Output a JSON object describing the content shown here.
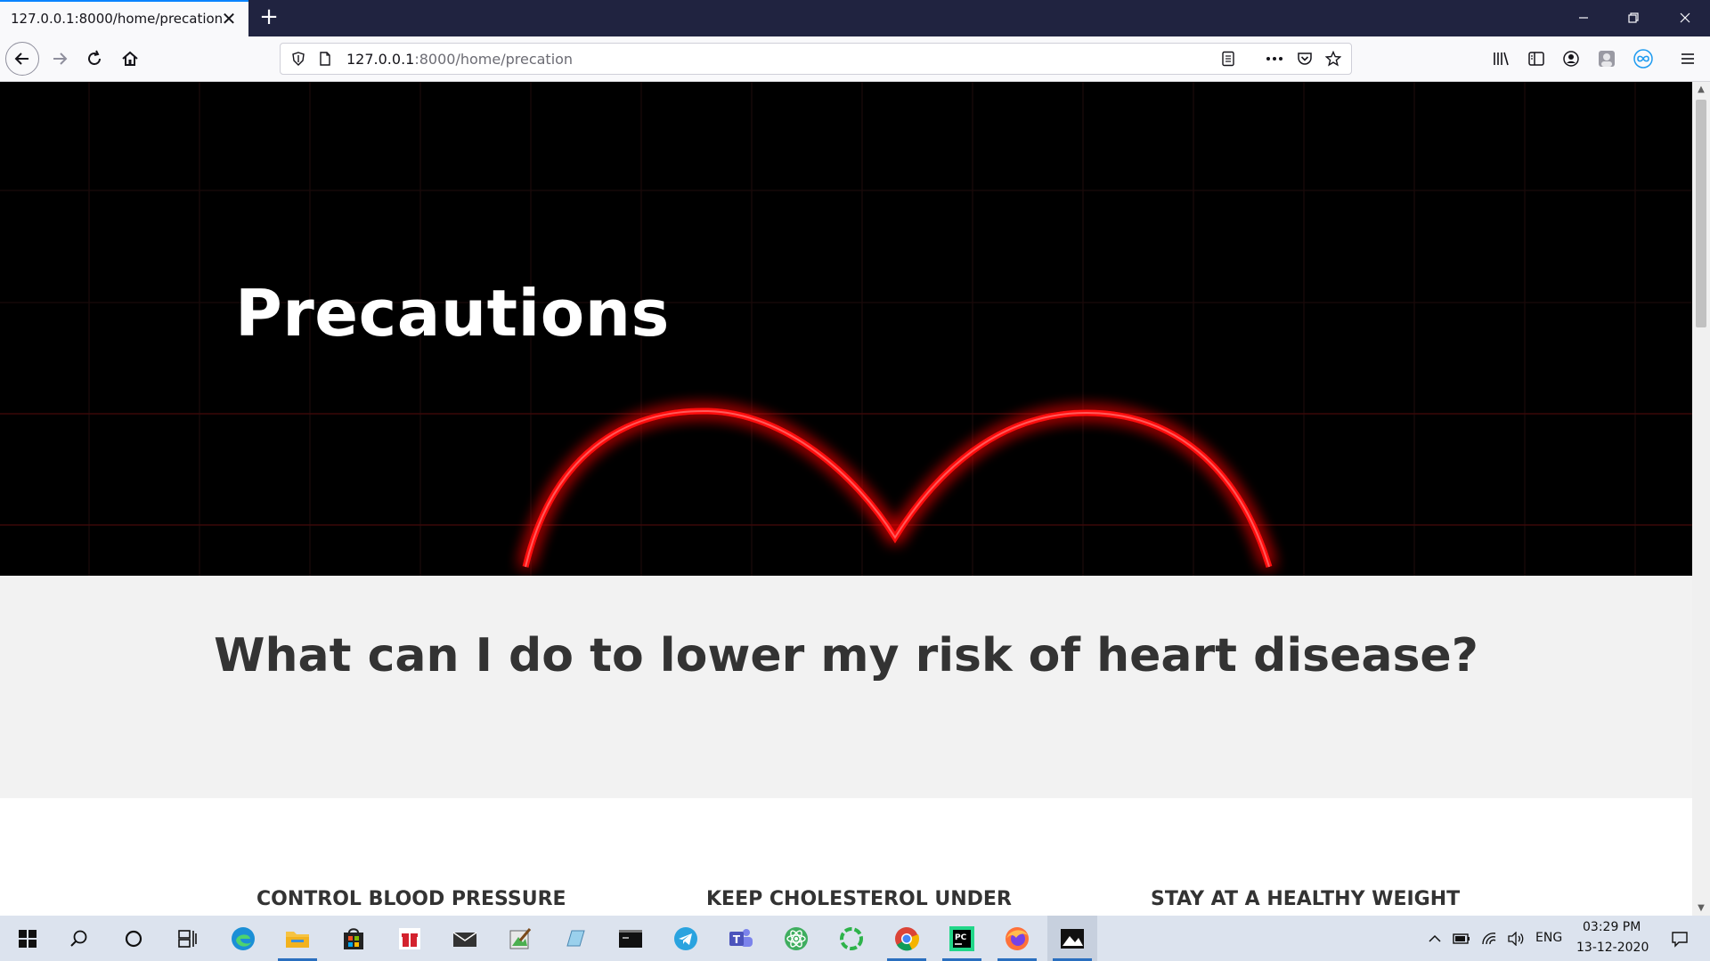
{
  "browser": {
    "tab_title": "127.0.0.1:8000/home/precation",
    "tab_close": "✕",
    "new_tab": "+",
    "url_host": "127.0.0.1",
    "url_path": ":8000/home/precation",
    "window_controls": {
      "minimize": "—",
      "restore": "❐",
      "close": "✕"
    }
  },
  "page": {
    "hero_title": "Precautions",
    "question": "What can I do to lower my risk of heart disease?",
    "cards": [
      {
        "title": "CONTROL BLOOD PRESSURE"
      },
      {
        "title": "KEEP CHOLESTEROL UNDER"
      },
      {
        "title": "STAY AT A HEALTHY WEIGHT"
      }
    ],
    "colors": {
      "hero_bg": "#000000",
      "glow": "#ff1010",
      "question_band": "#f2f2f2",
      "text_dark": "#333333"
    }
  },
  "taskbar": {
    "language": "ENG",
    "time": "03:29 PM",
    "date": "13-12-2020",
    "apps": [
      "start-icon",
      "search-icon",
      "cortana-icon",
      "task-view-icon",
      "edge-icon",
      "file-explorer-icon",
      "store-icon",
      "gift-icon",
      "mail-icon",
      "paint-icon",
      "notes-icon",
      "terminal-icon",
      "telegram-icon",
      "teams-icon",
      "atom-icon",
      "sync-icon",
      "chrome-icon",
      "pycharm-icon",
      "firefox-icon",
      "photos-icon"
    ]
  }
}
